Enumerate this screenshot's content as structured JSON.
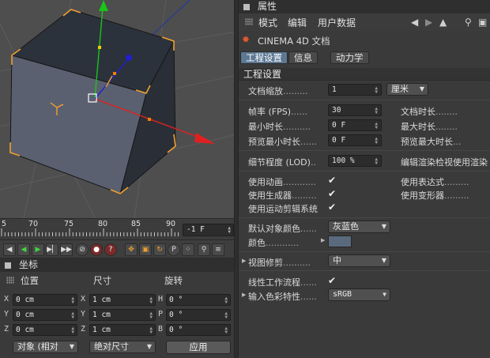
{
  "viewport": {
    "name": "3d-viewport"
  },
  "timeline": {
    "ticks": [
      "5",
      "70",
      "75",
      "80",
      "85",
      "90"
    ],
    "frame_value": "-1 F"
  },
  "coords": {
    "title": "坐标",
    "col_position": "位置",
    "col_size": "尺寸",
    "col_rotation": "旋转",
    "rows": [
      {
        "p_axis": "X",
        "p_val": "0 cm",
        "s_axis": "X",
        "s_val": "1 cm",
        "r_axis": "H",
        "r_val": "0 °"
      },
      {
        "p_axis": "Y",
        "p_val": "0 cm",
        "s_axis": "Y",
        "s_val": "1 cm",
        "r_axis": "P",
        "r_val": "0 °"
      },
      {
        "p_axis": "Z",
        "p_val": "0 cm",
        "s_axis": "Z",
        "s_val": "1 cm",
        "r_axis": "B",
        "r_val": "0 °"
      }
    ],
    "mode_dropdown": "对象 (相对",
    "size_dropdown": "绝对尺寸",
    "apply_button": "应用"
  },
  "attrs": {
    "title": "属性",
    "menu": {
      "mode": "模式",
      "edit": "编辑",
      "userdata": "用户数据"
    },
    "object_label": "CINEMA 4D 文档",
    "tabs": [
      "工程设置",
      "信息",
      "动力学"
    ],
    "section": "工程设置",
    "scale_label": "文档缩放",
    "scale_value": "1",
    "scale_unit": "厘米",
    "fps_label": "帧率 (FPS)",
    "fps_value": "30",
    "doc_length_label": "文档时长",
    "min_length_label": "最小时长",
    "min_length_value": "0 F",
    "max_length_label": "最大时长",
    "preview_min_label": "预览最小时长",
    "preview_min_value": "0 F",
    "preview_max_label": "预览最大时长",
    "lod_label": "细节程度 (LOD)",
    "lod_value": "100 %",
    "editor_lod_label": "编辑渲染检视使用渲染",
    "use_animation_label": "使用动画",
    "use_expression_label": "使用表达式",
    "use_generators_label": "使用生成器",
    "use_deformers_label": "使用变形器",
    "use_motion_label": "使用运动剪辑系统",
    "default_color_label": "默认对象颜色",
    "default_color_value": "灰蓝色",
    "color_label": "颜色",
    "view_clip_label": "视图修剪",
    "view_clip_value": "中",
    "linear_workflow_label": "线性工作流程",
    "input_color_label": "输入色彩特性",
    "input_color_value": "sRGB",
    "check_glyph": "✔"
  },
  "colors": {
    "accent_tab": "#5d7893",
    "swatch": "#5a6a7e",
    "axis_y": "#19c519",
    "axis_x": "#e02020",
    "axis_z": "#2020d0",
    "selection": "#f0a030"
  }
}
